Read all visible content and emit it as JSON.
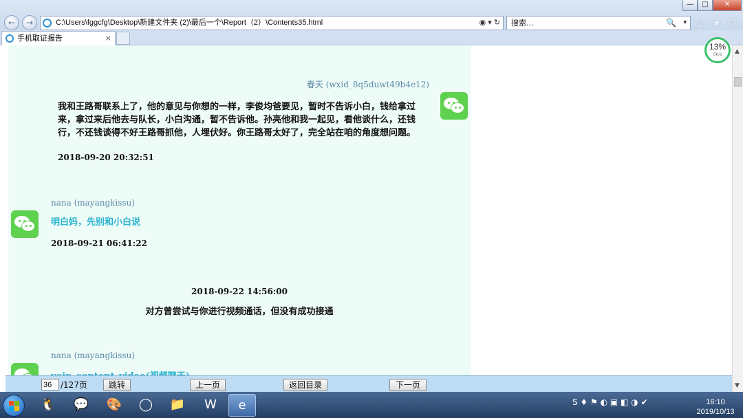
{
  "browser": {
    "address_url": "C:\\Users\\fggcfg\\Desktop\\新建文件夹 (2)\\最后一个\\Report（2）\\Contents35.html",
    "search_placeholder": "搜索...",
    "tab_title": "手机取证报告",
    "tab_close": "×",
    "window_controls": {
      "minimize": "—",
      "maximize": "□",
      "close": "✕"
    },
    "nav": {
      "back": "←",
      "forward": "→"
    },
    "address_tools": {
      "compat": "◉",
      "dropdown": "▾",
      "refresh": "↻"
    },
    "search_tools": {
      "search": "🔍",
      "dropdown": "▾"
    },
    "toolbar_icons": {
      "home": "⌂",
      "favorites": "★",
      "tools": "⚙"
    }
  },
  "speed_widget": {
    "percent": "13%",
    "rate": "0K/s"
  },
  "messages": [
    {
      "sender": "春天 (wxid_8q5duwt49b4e12)",
      "text": "我和王路哥联系上了，他的意见与你想的一样，李俊均爸要见，暂时不告诉小白，钱给拿过来，拿过来后他去与队长，小白沟通，暂不告诉他。孙亮他和我一起见，看他谈什么，还钱行，不还钱谈得不好王路哥抓他，人埋伏好。你王路哥太好了，完全站在咱的角度想问题。",
      "time": "2018-09-20 20:32:51"
    },
    {
      "sender": "nana (mayangkissu)",
      "text": "明白妈，先别和小白说",
      "time": "2018-09-21 06:41:22"
    },
    {
      "time": "2018-09-22 14:56:00",
      "text": "对方曾尝试与你进行视频通话，但没有成功接通"
    },
    {
      "sender": "nana (mayangkissu)",
      "text": "voip_content_video(视频聊天)"
    }
  ],
  "pager": {
    "current_page": "36",
    "total_label": "/127页",
    "jump_label": "跳转",
    "prev_label": "上一页",
    "toc_label": "返回目录",
    "next_label": "下一页"
  },
  "taskbar": {
    "tray_text": "S ♦ ⚑ ◐ ▣ ◧ ◑ ✔",
    "time": "16:10",
    "date": "2019/10/13"
  },
  "scrollbar": {
    "up": "▲",
    "down": "▼"
  }
}
